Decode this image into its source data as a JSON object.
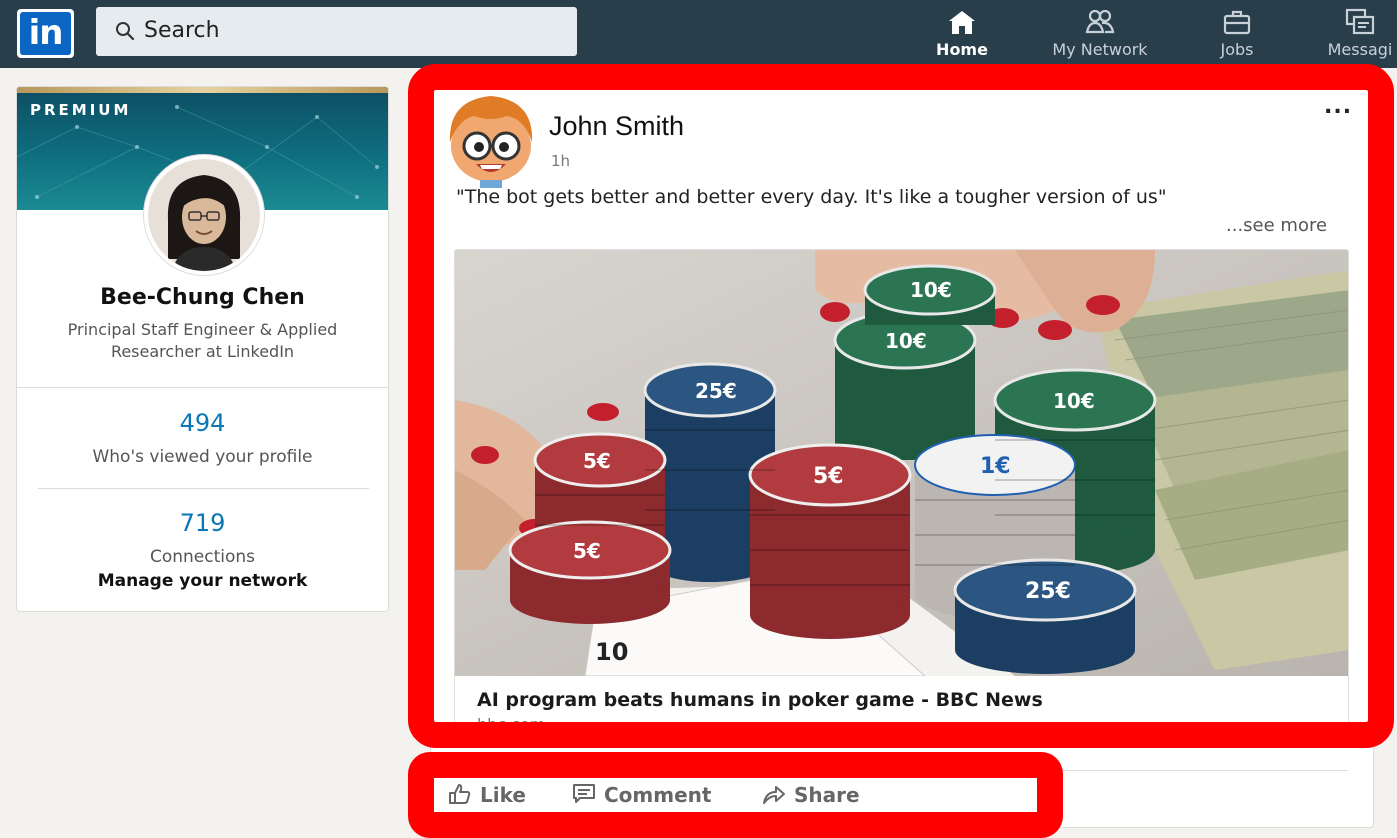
{
  "nav": {
    "logo_text": "in",
    "search_placeholder": "Search",
    "items": [
      {
        "label": "Home",
        "icon": "home-icon",
        "active": true
      },
      {
        "label": "My Network",
        "icon": "network-icon"
      },
      {
        "label": "Jobs",
        "icon": "briefcase-icon"
      },
      {
        "label": "Messagi",
        "icon": "messaging-icon"
      }
    ]
  },
  "profile": {
    "badge": "PREMIUM",
    "name": "Bee-Chung Chen",
    "headline": "Principal Staff Engineer & Applied Researcher at LinkedIn",
    "views_count": "494",
    "views_label": "Who's viewed your profile",
    "connections_count": "719",
    "connections_label": "Connections",
    "manage_label": "Manage your network"
  },
  "post": {
    "author": "John Smith",
    "time": "1h",
    "menu": "...",
    "text": "\"The bot gets better and better every day. It's like a tougher version of us\"",
    "see_more": "...see more",
    "article_title": "AI program beats humans in poker game - BBC News",
    "article_source": "bbc.com"
  },
  "actions": {
    "like": "Like",
    "comment": "Comment",
    "share": "Share"
  },
  "colors": {
    "nav_bg": "#283e4a",
    "brand_blue": "#0a66c2",
    "stat_blue": "#0a77b5",
    "highlight_red": "#ff0000"
  }
}
